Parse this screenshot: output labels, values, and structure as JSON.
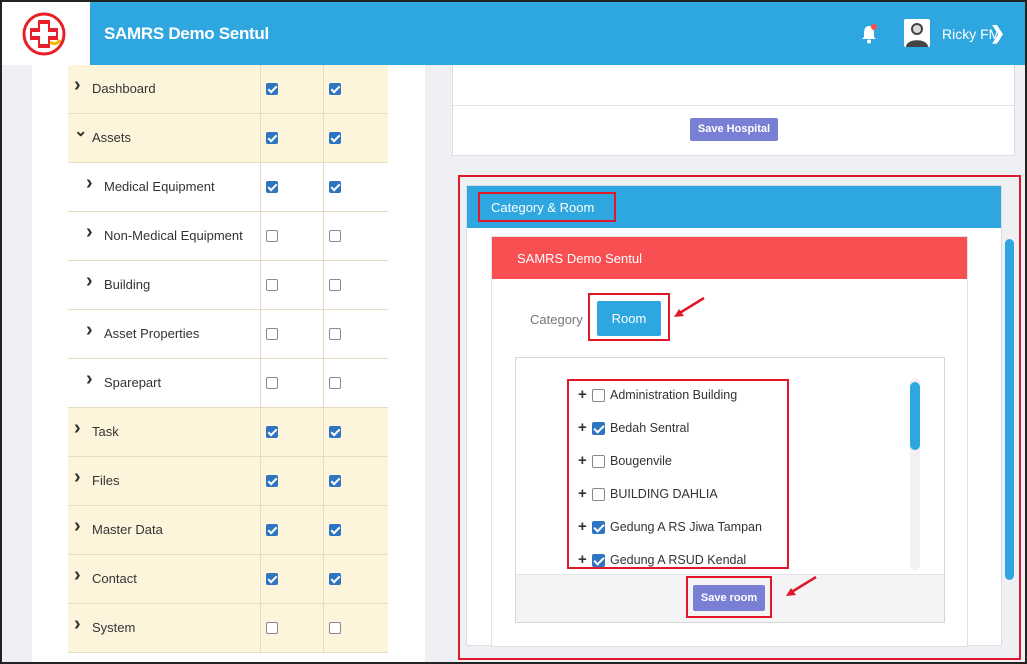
{
  "topbar": {
    "app_title": "SAMRS Demo Sentul",
    "user_name": "Ricky FM"
  },
  "colors": {
    "primary": "#2ea7e0",
    "danger": "#f74f52",
    "purple_button": "#7a7fd6",
    "highlight_row": "#fdf4dc",
    "annotation_red": "#e0182a"
  },
  "permissions": {
    "rows": [
      {
        "label": "Dashboard",
        "indent": 0,
        "expanded": false,
        "col1": true,
        "col2": true,
        "highlight": true
      },
      {
        "label": "Assets",
        "indent": 0,
        "expanded": true,
        "col1": true,
        "col2": true,
        "highlight": true
      },
      {
        "label": "Medical Equipment",
        "indent": 1,
        "expanded": false,
        "col1": true,
        "col2": true,
        "highlight": false
      },
      {
        "label": "Non-Medical Equipment",
        "indent": 1,
        "expanded": false,
        "col1": false,
        "col2": false,
        "highlight": false
      },
      {
        "label": "Building",
        "indent": 1,
        "expanded": false,
        "col1": false,
        "col2": false,
        "highlight": false
      },
      {
        "label": "Asset Properties",
        "indent": 1,
        "expanded": false,
        "col1": false,
        "col2": false,
        "highlight": false
      },
      {
        "label": "Sparepart",
        "indent": 1,
        "expanded": false,
        "col1": false,
        "col2": false,
        "highlight": false
      },
      {
        "label": "Task",
        "indent": 0,
        "expanded": false,
        "col1": true,
        "col2": true,
        "highlight": true
      },
      {
        "label": "Files",
        "indent": 0,
        "expanded": false,
        "col1": true,
        "col2": true,
        "highlight": true
      },
      {
        "label": "Master Data",
        "indent": 0,
        "expanded": false,
        "col1": true,
        "col2": true,
        "highlight": true
      },
      {
        "label": "Contact",
        "indent": 0,
        "expanded": false,
        "col1": true,
        "col2": true,
        "highlight": true
      },
      {
        "label": "System",
        "indent": 0,
        "expanded": false,
        "col1": false,
        "col2": false,
        "highlight": true
      }
    ]
  },
  "hospital": {
    "save_label": "Save Hospital"
  },
  "category_room": {
    "title": "Category & Room",
    "inner_title": "SAMRS Demo Sentul",
    "tab_category": "Category",
    "tab_room": "Room",
    "save_room_label": "Save room",
    "rooms": [
      {
        "label": "Administration Building",
        "checked": false
      },
      {
        "label": "Bedah Sentral",
        "checked": true
      },
      {
        "label": "Bougenvile",
        "checked": false
      },
      {
        "label": "BUILDING DAHLIA",
        "checked": false
      },
      {
        "label": "Gedung A RS Jiwa Tampan",
        "checked": true
      },
      {
        "label": "Gedung A RSUD Kendal",
        "checked": true
      }
    ]
  }
}
